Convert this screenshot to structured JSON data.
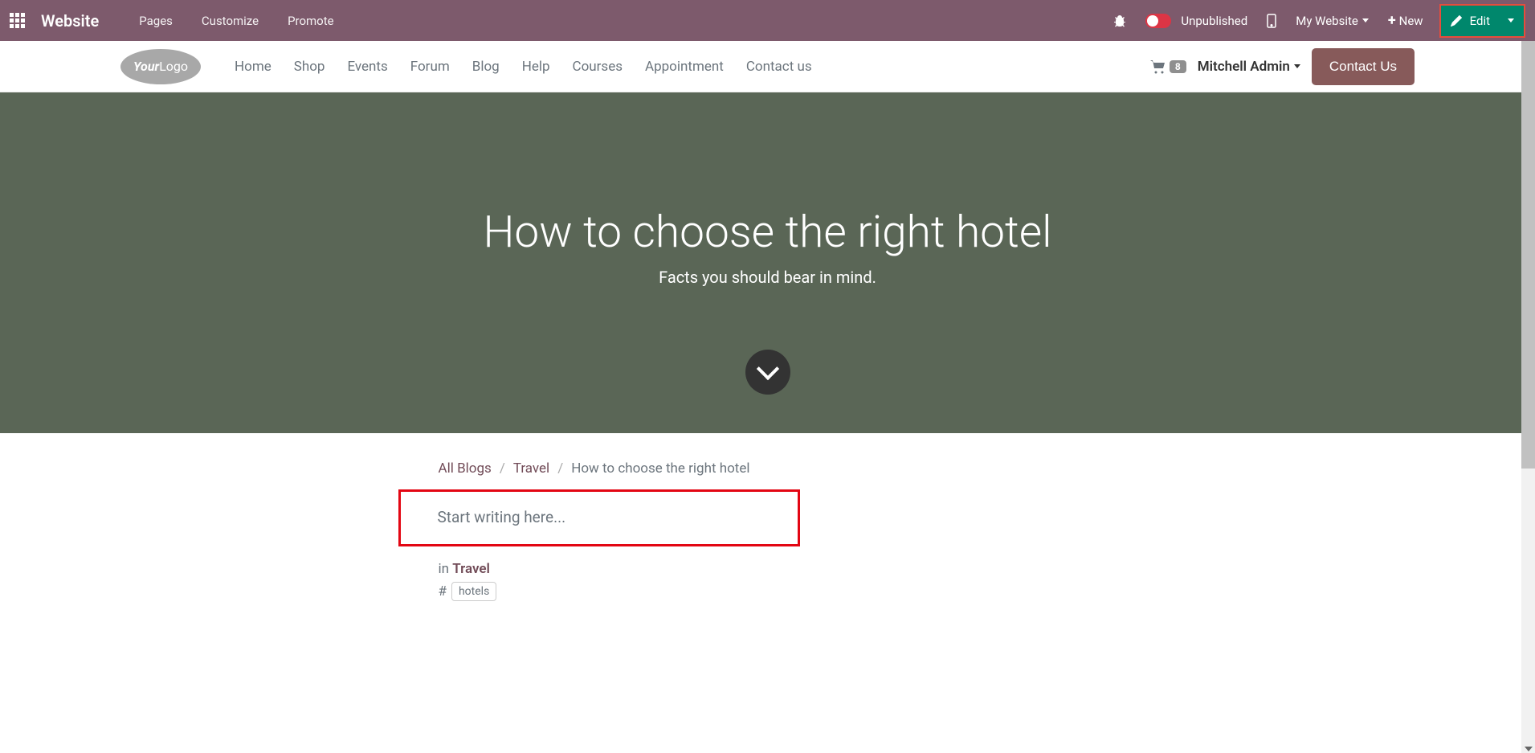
{
  "topbar": {
    "brand": "Website",
    "menu": [
      "Pages",
      "Customize",
      "Promote"
    ],
    "publish_status": "Unpublished",
    "my_website": "My Website",
    "new": "New",
    "edit": "Edit"
  },
  "navbar": {
    "logo_text_1": "Your",
    "logo_text_2": "Logo",
    "items": [
      "Home",
      "Shop",
      "Events",
      "Forum",
      "Blog",
      "Help",
      "Courses",
      "Appointment",
      "Contact us"
    ],
    "cart_count": "8",
    "user": "Mitchell Admin",
    "contact": "Contact Us"
  },
  "hero": {
    "title": "How to choose the right hotel",
    "subtitle": "Facts you should bear in mind."
  },
  "breadcrumb": {
    "all": "All Blogs",
    "cat": "Travel",
    "current": "How to choose the right hotel"
  },
  "editor": {
    "placeholder": "Start writing here..."
  },
  "meta": {
    "in": "in",
    "category": "Travel",
    "tags": [
      "hotels"
    ]
  }
}
